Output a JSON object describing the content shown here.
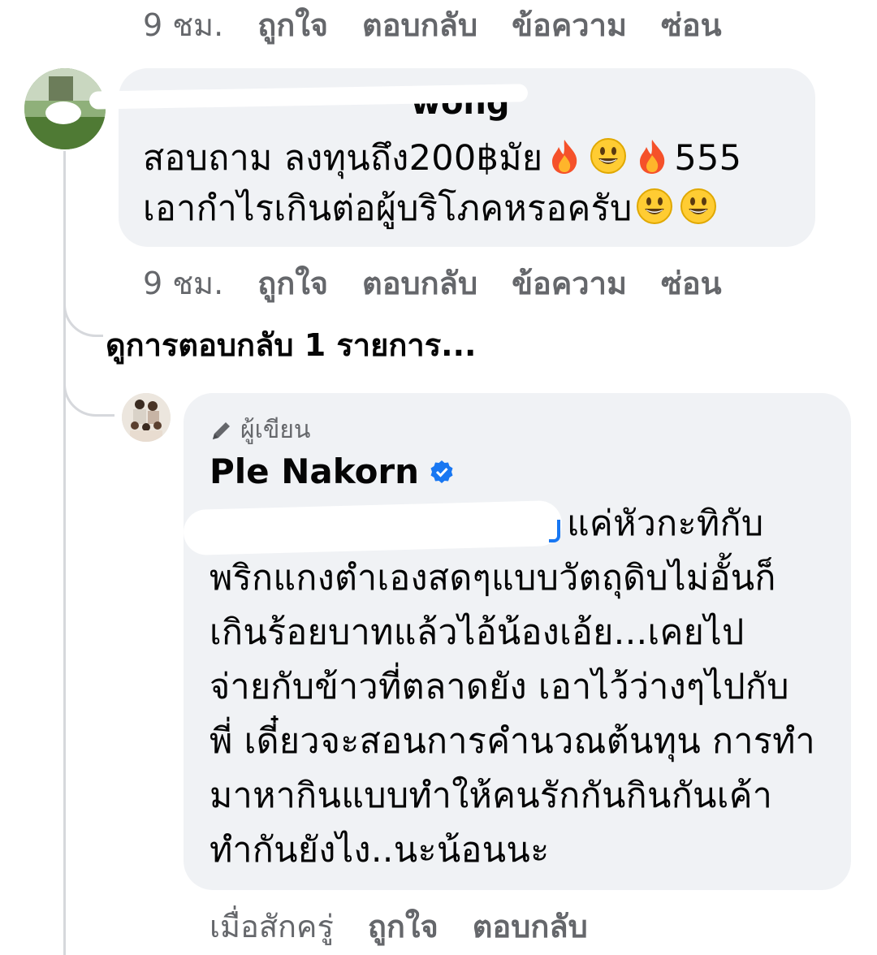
{
  "top_actions": {
    "time": "9 ชม.",
    "like": "ถูกใจ",
    "reply": "ตอบกลับ",
    "message": "ข้อความ",
    "hide": "ซ่อน"
  },
  "comment1": {
    "author_partial": "wong",
    "text_line1": "สอบถาม ลงทุนถึง200฿มัย",
    "text_line1_suffix": "555",
    "text_line2": "เอากำไรเกินต่อผู้บริโภคหรอครับ",
    "emojis_line1": [
      "fire-emoji",
      "grinning-emoji",
      "fire-emoji"
    ],
    "emojis_line2": [
      "grinning-emoji",
      "grinning-emoji"
    ]
  },
  "comment1_actions": {
    "time": "9 ชม.",
    "like": "ถูกใจ",
    "reply": "ตอบกลับ",
    "message": "ข้อความ",
    "hide": "ซ่อน"
  },
  "view_replies": "ดูการตอบกลับ 1 รายการ...",
  "reply": {
    "author_badge": "ผู้เขียน",
    "author_name": "Ple Nakorn",
    "verified_icon": "verified-badge-icon",
    "lines": [
      "แค่หัวกะทิกับ",
      "พริกแกงตำเองสดๆแบบวัตถุดิบไม่อั้นก็",
      "เกินร้อยบาทแล้วไอ้น้องเอ้ย...เคยไป",
      "จ่ายกับข้าวที่ตลาดยัง เอาไว้ว่างๆไปกับ",
      "พี่ เดี๋ยวจะสอนการคำนวณต้นทุน การทำ",
      "มาหากินแบบทำให้คนรักกันกินกันเค้า",
      "ทำกันยังไง..นะน้อนนะ"
    ]
  },
  "reply_actions": {
    "time": "เมื่อสักครู่",
    "like": "ถูกใจ",
    "reply": "ตอบกลับ"
  },
  "colors": {
    "bubble": "#f0f2f5",
    "muted": "#65676b",
    "verified": "#1877f2",
    "thread_line": "#d6d8dc"
  }
}
